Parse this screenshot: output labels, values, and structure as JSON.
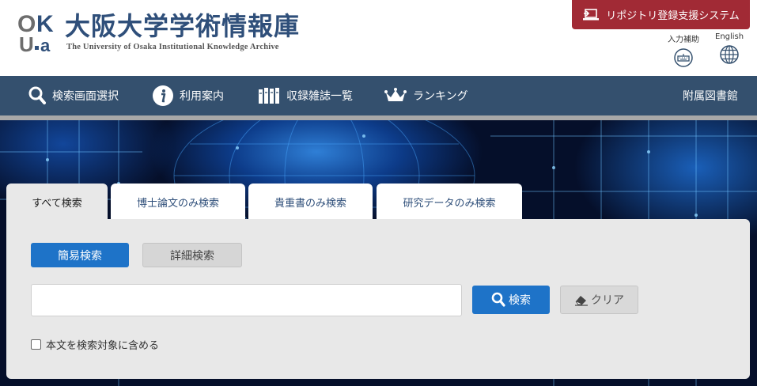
{
  "logo": {
    "mark_top": "OK",
    "mark_bottom": "U.a",
    "title": "大阪大学学術情報庫",
    "subtitle": "The University of Osaka Institutional Knowledge Archive"
  },
  "header": {
    "repo_button": "リポジトリ登録支援システム",
    "input_aid": "入力補助",
    "english": "English"
  },
  "nav": {
    "items": [
      {
        "label": "検索画面選択",
        "icon": "search-icon"
      },
      {
        "label": "利用案内",
        "icon": "info-icon"
      },
      {
        "label": "収録雑誌一覧",
        "icon": "books-icon"
      },
      {
        "label": "ランキング",
        "icon": "crown-icon"
      }
    ],
    "library": "附属図書館"
  },
  "tabs": [
    {
      "label": "すべて検索",
      "active": true
    },
    {
      "label": "博士論文のみ検索",
      "active": false
    },
    {
      "label": "貴重書のみ検索",
      "active": false
    },
    {
      "label": "研究データのみ検索",
      "active": false
    }
  ],
  "search": {
    "mode_simple": "簡易検索",
    "mode_detail": "詳細検索",
    "query_value": "",
    "query_placeholder": "",
    "search_button": "検索",
    "clear_button": "クリア",
    "fulltext_label": "本文を検索対象に含める"
  },
  "colors": {
    "nav_bg": "#34506e",
    "repo_red": "#a12a35",
    "primary_blue": "#1e73c8",
    "brand_navy": "#2f4f7a"
  }
}
